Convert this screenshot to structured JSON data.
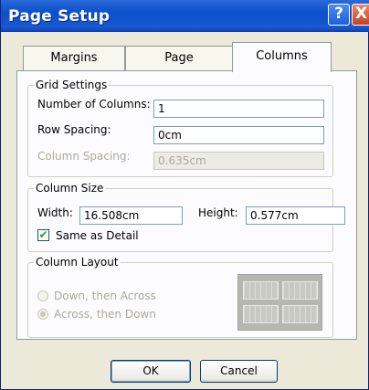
{
  "window": {
    "title": "Page Setup",
    "help_glyph": "?",
    "close_glyph": "X"
  },
  "tabs": [
    {
      "label": "Margins",
      "active": false
    },
    {
      "label": "Page",
      "active": false
    },
    {
      "label": "Columns",
      "active": true
    }
  ],
  "grid_settings": {
    "legend": "Grid Settings",
    "num_columns_label": "Number of Columns:",
    "num_columns_value": "1",
    "row_spacing_label": "Row Spacing:",
    "row_spacing_value": "0cm",
    "column_spacing_label": "Column Spacing:",
    "column_spacing_value": "0.635cm",
    "column_spacing_disabled": true
  },
  "column_size": {
    "legend": "Column Size",
    "width_label": "Width:",
    "width_value": "16.508cm",
    "height_label": "Height:",
    "height_value": "0.577cm",
    "same_as_detail_label": "Same as Detail",
    "same_as_detail_checked": true,
    "check_glyph": "✔"
  },
  "column_layout": {
    "legend": "Column Layout",
    "options": [
      {
        "label": "Down, then Across",
        "selected": false,
        "disabled": true
      },
      {
        "label": "Across, then Down",
        "selected": true,
        "disabled": true
      }
    ],
    "preview_icon": "column-layout-preview"
  },
  "buttons": {
    "ok": "OK",
    "cancel": "Cancel"
  }
}
